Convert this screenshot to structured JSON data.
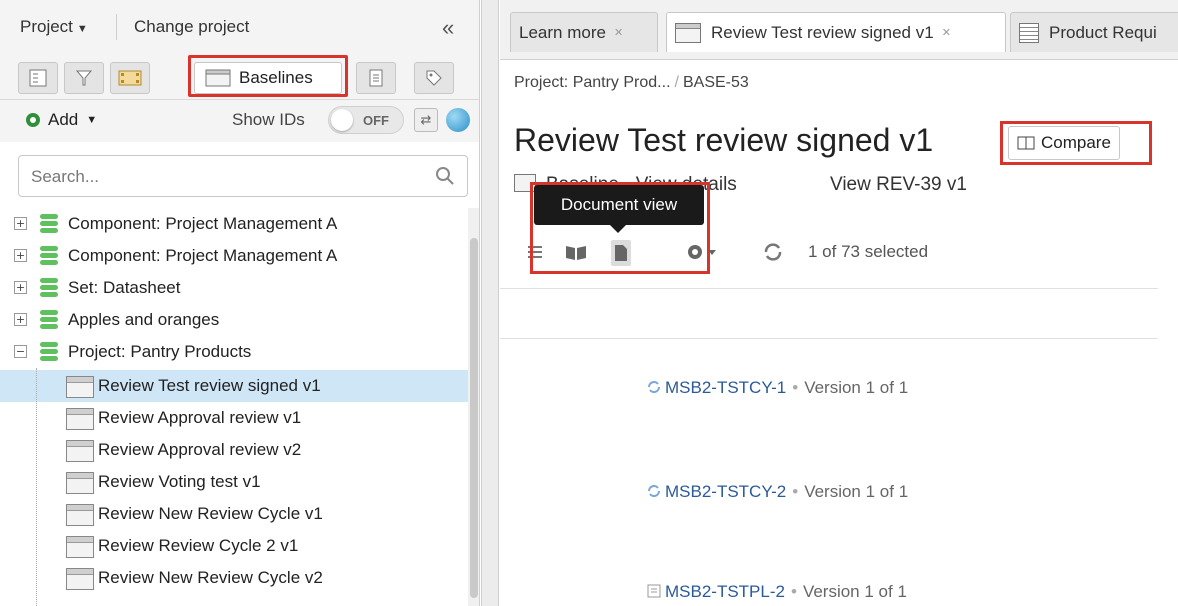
{
  "left": {
    "project_menu": "Project",
    "change_project": "Change project",
    "collapse_glyph": "«",
    "tabs": {
      "baselines_label": "Baselines"
    },
    "add_label": "Add",
    "show_ids_label": "Show IDs",
    "show_ids_state": "OFF",
    "search_placeholder": "Search...",
    "tree": [
      {
        "label": "Component: Project Management A",
        "expander": "+"
      },
      {
        "label": "Component: Project Management A",
        "expander": "+"
      },
      {
        "label": "Set: Datasheet",
        "expander": "+"
      },
      {
        "label": "Apples and oranges",
        "expander": "+"
      },
      {
        "label": "Project: Pantry Products",
        "expander": "−"
      }
    ],
    "children": [
      {
        "label": "Review Test review signed v1",
        "selected": true
      },
      {
        "label": "Review Approval review v1"
      },
      {
        "label": "Review Approval review v2"
      },
      {
        "label": "Review Voting test v1"
      },
      {
        "label": "Review New Review Cycle v1"
      },
      {
        "label": "Review Review Cycle 2 v1"
      },
      {
        "label": "Review New Review Cycle v2"
      }
    ]
  },
  "right": {
    "tabs": [
      {
        "label": "Learn more"
      },
      {
        "label": "Review Test review signed v1"
      },
      {
        "label": "Product Requi"
      }
    ],
    "breadcrumb": {
      "project": "Project: Pantry Prod...",
      "sep": "/",
      "item": "BASE-53"
    },
    "title": "Review Test review signed v1",
    "compare_label": "Compare",
    "links": {
      "view_details": "Baseline · View details",
      "view_rev": "View REV-39 v1"
    },
    "tooltip": "Document view",
    "selection": "1 of 73 selected",
    "items": [
      {
        "id": "MSB2-TSTCY-1",
        "version": "Version 1 of 1"
      },
      {
        "id": "MSB2-TSTCY-2",
        "version": "Version 1 of 1"
      },
      {
        "id": "MSB2-TSTPL-2",
        "version": "Version 1 of 1"
      }
    ]
  },
  "colors": {
    "highlight": "#d9342b",
    "selection_bg": "#cfe6f7",
    "link": "#2a5a9a",
    "db_icon": "#5ec05e"
  }
}
